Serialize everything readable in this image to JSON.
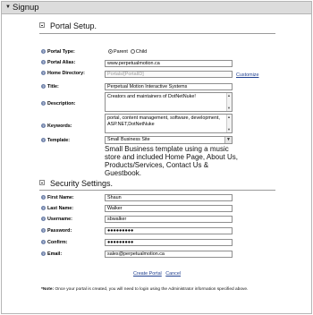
{
  "window": {
    "title": "Signup"
  },
  "portal_section": {
    "title": "Portal Setup.",
    "labels": {
      "type": "Portal Type:",
      "alias": "Portal Alias:",
      "home": "Home Directory:",
      "title": "Title:",
      "description": "Description:",
      "keywords": "Keywords:",
      "template": "Template:"
    },
    "type_options": {
      "parent": "Parent",
      "child": "Child",
      "selected": "parent"
    },
    "alias_value": "www.perpetualmotion.ca",
    "home_value": "Portals/[PortalID]",
    "customize_label": "Customize",
    "title_value": "Perpetual Motion Interactive Systems",
    "description_value": "Creators and maintainers of DotNetNuke!",
    "keywords_value": "portal, content management, software, development, ASP.NET,DotNetNuke",
    "template_value": "Small Business Site",
    "template_description": "Small Business template using a music store and included Home Page, About Us, Products/Services, Contact Us & Guestbook."
  },
  "security_section": {
    "title": "Security Settings.",
    "labels": {
      "first": "First Name:",
      "last": "Last Name:",
      "user": "Username:",
      "pass": "Password:",
      "confirm": "Confirm:",
      "email": "Email:"
    },
    "first_value": "Shaun",
    "last_value": "Walker",
    "user_value": "sbwalker",
    "pass_value": "●●●●●●●●●",
    "confirm_value": "●●●●●●●●●",
    "email_value": "sales@perpetualmotion.ca"
  },
  "actions": {
    "create": "Create Portal",
    "cancel": "Cancel"
  },
  "note": {
    "bold": "*Note:",
    "text": " Once your portal is created, you will need to login using the Administrator information specified above."
  },
  "icons": {
    "help": "help-icon",
    "collapse": "collapse-minus-icon",
    "expand_arrow": "triangle-down-icon"
  }
}
